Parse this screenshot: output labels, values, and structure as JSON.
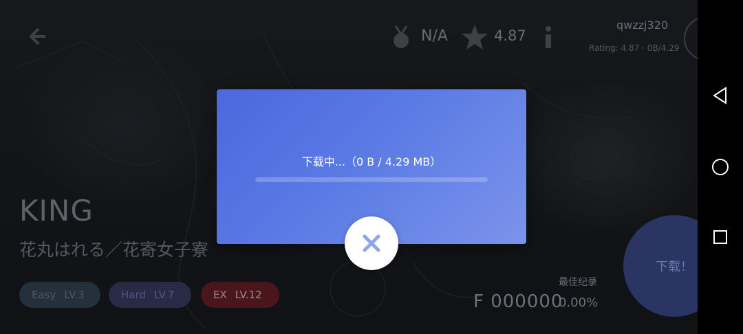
{
  "header": {
    "rank": "N/A",
    "rating": "4.87",
    "username": "qwzzj320",
    "user_subtitle": "Rating: 4.87  ·  0B/4.29"
  },
  "song": {
    "title": "KING",
    "artist": "花丸はれる／花寄女子寮"
  },
  "difficulties": [
    {
      "name": "Easy",
      "level": "LV.3"
    },
    {
      "name": "Hard",
      "level": "LV.7"
    },
    {
      "name": "EX",
      "level": "LV.12"
    }
  ],
  "record": {
    "label": "最佳纪录",
    "score": "F 000000",
    "accuracy": "0.00%"
  },
  "download_button": {
    "label": "下载！"
  },
  "dialog": {
    "status_text": "下载中...（0 B / 4.29 MB）",
    "progress_fraction": 0.0
  },
  "icons": {
    "back": "back-arrow-icon",
    "medal": "medal-icon",
    "star": "star-icon",
    "info": "info-icon",
    "close": "close-icon",
    "nav_back": "nav-back-triangle-icon",
    "nav_home": "nav-home-circle-icon",
    "nav_recents": "nav-recents-square-icon"
  },
  "colors": {
    "dialog_gradient_start": "#4c68de",
    "dialog_gradient_end": "#7b93ea",
    "close_icon": "#8fa4ec"
  }
}
